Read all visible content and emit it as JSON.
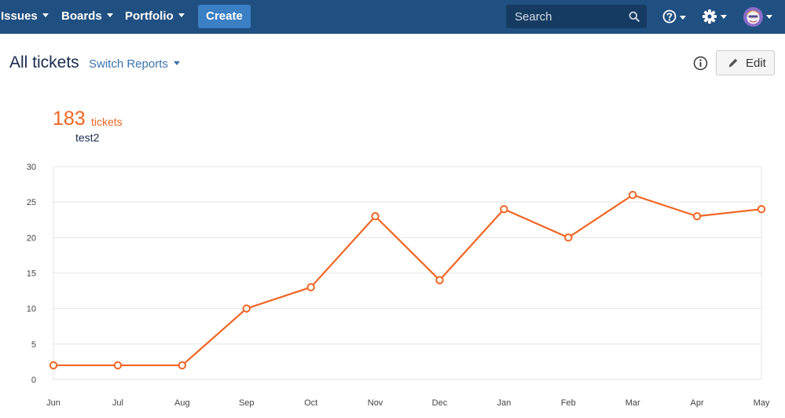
{
  "nav": {
    "issues_label": "Issues",
    "boards_label": "Boards",
    "portfolio_label": "Portfolio",
    "create_label": "Create",
    "search_placeholder": "Search"
  },
  "page": {
    "title": "All tickets",
    "switch_reports_label": "Switch Reports",
    "edit_label": "Edit"
  },
  "summary": {
    "count": "183",
    "unit": "tickets",
    "series_name": "test2"
  },
  "colors": {
    "topbar": "#205081",
    "accent": "#f06623",
    "create_button": "#3b7fc4"
  },
  "icons": [
    "search-icon",
    "help-icon",
    "gear-icon",
    "avatar",
    "info-icon",
    "pencil-icon"
  ],
  "chart_data": {
    "type": "line",
    "categories": [
      "Jun",
      "Jul",
      "Aug",
      "Sep",
      "Oct",
      "Nov",
      "Dec",
      "Jan",
      "Feb",
      "Mar",
      "Apr",
      "May"
    ],
    "series": [
      {
        "name": "test2",
        "values": [
          2,
          2,
          2,
          10,
          13,
          23,
          14,
          24,
          20,
          26,
          23,
          24
        ]
      }
    ],
    "ylim": [
      0,
      30
    ],
    "yticks": [
      0,
      5,
      10,
      15,
      20,
      25,
      30
    ],
    "grid": true,
    "color": "#f06623"
  }
}
